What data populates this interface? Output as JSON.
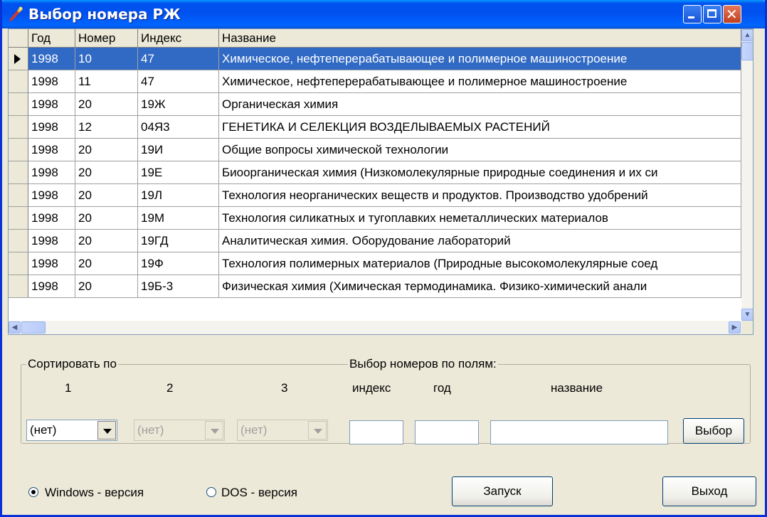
{
  "window": {
    "title": "Выбор номера РЖ"
  },
  "table": {
    "headers": [
      "Год",
      "Номер",
      "Индекс",
      "Название"
    ],
    "rows": [
      [
        "1998",
        "10",
        "47",
        "Химическое, нефтеперерабатывающее и полимерное машиностроение"
      ],
      [
        "1998",
        "11",
        "47",
        "Химическое, нефтеперерабатывающее и полимерное машиностроение"
      ],
      [
        "1998",
        "20",
        "19Ж",
        "Органическая химия"
      ],
      [
        "1998",
        "12",
        "04Я3",
        "ГЕНЕТИКА И СЕЛЕКЦИЯ ВОЗДЕЛЫВАЕМЫХ РАСТЕНИЙ"
      ],
      [
        "1998",
        "20",
        "19И",
        "Общие вопросы химической технологии"
      ],
      [
        "1998",
        "20",
        "19Е",
        "Биоорганическая химия (Низкомолекулярные природные соединения и их си"
      ],
      [
        "1998",
        "20",
        "19Л",
        "Технология неорганических веществ и продуктов. Производство удобрений"
      ],
      [
        "1998",
        "20",
        "19М",
        "Технология силикатных и тугоплавких неметаллических материалов"
      ],
      [
        "1998",
        "20",
        "19ГД",
        "Аналитическая химия. Оборудование лабораторий"
      ],
      [
        "1998",
        "20",
        "19Ф",
        "Технология полимерных материалов (Природные высокомолекулярные соед"
      ],
      [
        "1998",
        "20",
        "19Б-3",
        "Физическая химия (Химическая термодинамика. Физико-химический анали"
      ]
    ]
  },
  "sort": {
    "legend": "Сортировать по",
    "labels": [
      "1",
      "2",
      "3"
    ],
    "values": [
      "(нет)",
      "(нет)",
      "(нет)"
    ]
  },
  "filter": {
    "legend": "Выбор номеров по полям:",
    "index_label": "индекс",
    "year_label": "год",
    "name_label": "название",
    "index_value": "",
    "year_value": "",
    "name_value": "",
    "select_button": "Выбор"
  },
  "version": {
    "windows_label": "Windows - версия",
    "dos_label": "DOS - версия",
    "selected": "windows"
  },
  "buttons": {
    "run": "Запуск",
    "exit": "Выход"
  }
}
